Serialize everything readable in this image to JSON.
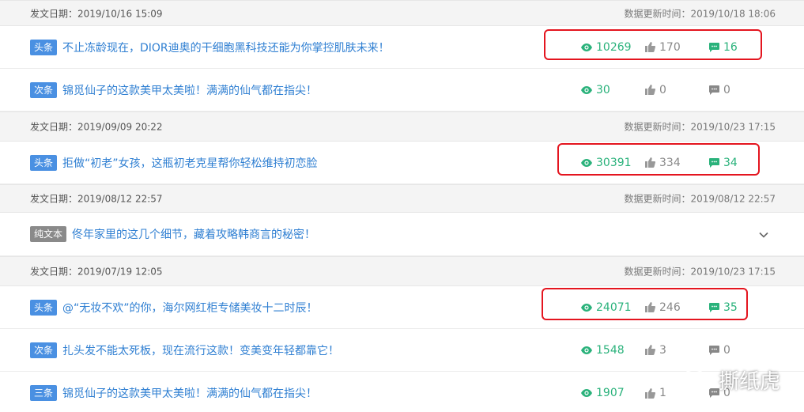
{
  "groups": [
    {
      "date": "发文日期：2019/10/16 15:09",
      "updated": "数据更新时间：2019/10/18 18:06",
      "rows": [
        {
          "tag": "头条",
          "title": "不止冻龄现在，DIOR迪奥的干细胞黑科技还能为你掌控肌肤未来！",
          "views": "10269",
          "likes": "170",
          "comments": "16"
        },
        {
          "tag": "次条",
          "title": "锦觅仙子的这款美甲太美啦！满满的仙气都在指尖！",
          "views": "30",
          "likes": "0",
          "comments": "0"
        }
      ]
    },
    {
      "date": "发文日期：2019/09/09 20:22",
      "updated": "数据更新时间：2019/10/23 17:15",
      "rows": [
        {
          "tag": "头条",
          "title": "拒做“初老”女孩，这瓶初老克星帮你轻松维持初恋脸",
          "views": "30391",
          "likes": "334",
          "comments": "34"
        }
      ]
    },
    {
      "date": "发文日期：2019/08/12 22:57",
      "updated": "数据更新时间：2019/08/12 22:57",
      "rows": [
        {
          "tag": "纯文本",
          "title": "佟年家里的这几个细节，藏着攻略韩商言的秘密！"
        }
      ]
    },
    {
      "date": "发文日期：2019/07/19 12:05",
      "updated": "数据更新时间：2019/10/23 17:15",
      "rows": [
        {
          "tag": "头条",
          "title": "@“无妆不欢”的你，海尔网红柜专储美妆十二时辰！",
          "views": "24071",
          "likes": "246",
          "comments": "35"
        },
        {
          "tag": "次条",
          "title": "扎头发不能太死板，现在流行这款！变美变年轻都靠它！",
          "views": "1548",
          "likes": "3",
          "comments": "0"
        },
        {
          "tag": "三条",
          "title": "锦觅仙子的这款美甲太美啦！满满的仙气都在指尖！",
          "views": "1907",
          "likes": "1",
          "comments": "0"
        }
      ]
    }
  ],
  "watermark": "撕纸虎",
  "icons": {
    "views": "eye-icon",
    "likes": "thumbs-up-icon",
    "comments": "comment-icon",
    "expand": "chevron-down-icon",
    "watermark": "wechat-logo-icon"
  },
  "colors": {
    "link": "#2f7fd2",
    "accent_green": "#2ab27b",
    "tag_blue": "#4a90e2",
    "tag_gray": "#8a8a8a",
    "highlight_red": "#e4151f"
  }
}
